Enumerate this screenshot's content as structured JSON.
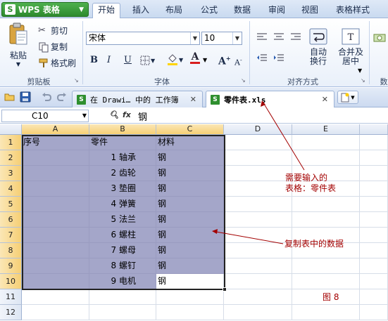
{
  "app": {
    "name": "WPS 表格",
    "logo_letter": "S"
  },
  "menu": {
    "tabs": [
      "开始",
      "插入",
      "布局",
      "公式",
      "数据",
      "审阅",
      "视图",
      "表格样式"
    ],
    "active_index": 0
  },
  "ribbon": {
    "clipboard": {
      "paste_label": "粘贴",
      "cut_label": "剪切",
      "copy_label": "复制",
      "format_painter_label": "格式刷",
      "group_label": "剪贴板"
    },
    "font": {
      "font_name": "宋体",
      "font_size": "10",
      "bold": "B",
      "italic": "I",
      "underline": "U",
      "grow": "A",
      "shrink": "A",
      "color_letter": "A",
      "group_label": "字体"
    },
    "alignment": {
      "wrap_label_1": "自动",
      "wrap_label_2": "换行",
      "merge_label_1": "合并及",
      "merge_label_2": "居中",
      "group_label": "对齐方式"
    },
    "extra": {
      "partial_label": "数"
    }
  },
  "doc_tabs": [
    {
      "label": "在 Drawi… 中的 工作簿",
      "active": false
    },
    {
      "label": "零件表.xls",
      "active": true
    }
  ],
  "formula_bar": {
    "cell_ref": "C10",
    "fx_label": "fx",
    "content": "钢"
  },
  "sheet": {
    "columns": [
      "A",
      "B",
      "C",
      "D",
      "E"
    ],
    "rows": [
      "1",
      "2",
      "3",
      "4",
      "5",
      "6",
      "7",
      "8",
      "9",
      "10",
      "11",
      "12"
    ],
    "header_row": [
      "序号",
      "零件",
      "材料"
    ],
    "data": [
      [
        "",
        "1 轴承",
        "钢"
      ],
      [
        "",
        "2 齿轮",
        "钢"
      ],
      [
        "",
        "3 垫圈",
        "钢"
      ],
      [
        "",
        "4 弹簧",
        "钢"
      ],
      [
        "",
        "5 法兰",
        "钢"
      ],
      [
        "",
        "6 螺柱",
        "钢"
      ],
      [
        "",
        "7 螺母",
        "钢"
      ],
      [
        "",
        "8 螺钉",
        "钢"
      ],
      [
        "",
        "9 电机",
        "钢"
      ]
    ]
  },
  "annotations": {
    "note1_line1": "需要输入的",
    "note1_line2": "表格：零件表",
    "note2": "复制表中的数据",
    "figure": "图 8"
  },
  "colors": {
    "accent_green": "#2d8a2d",
    "selection": "#a4a6c9",
    "annotation": "#a30000"
  }
}
